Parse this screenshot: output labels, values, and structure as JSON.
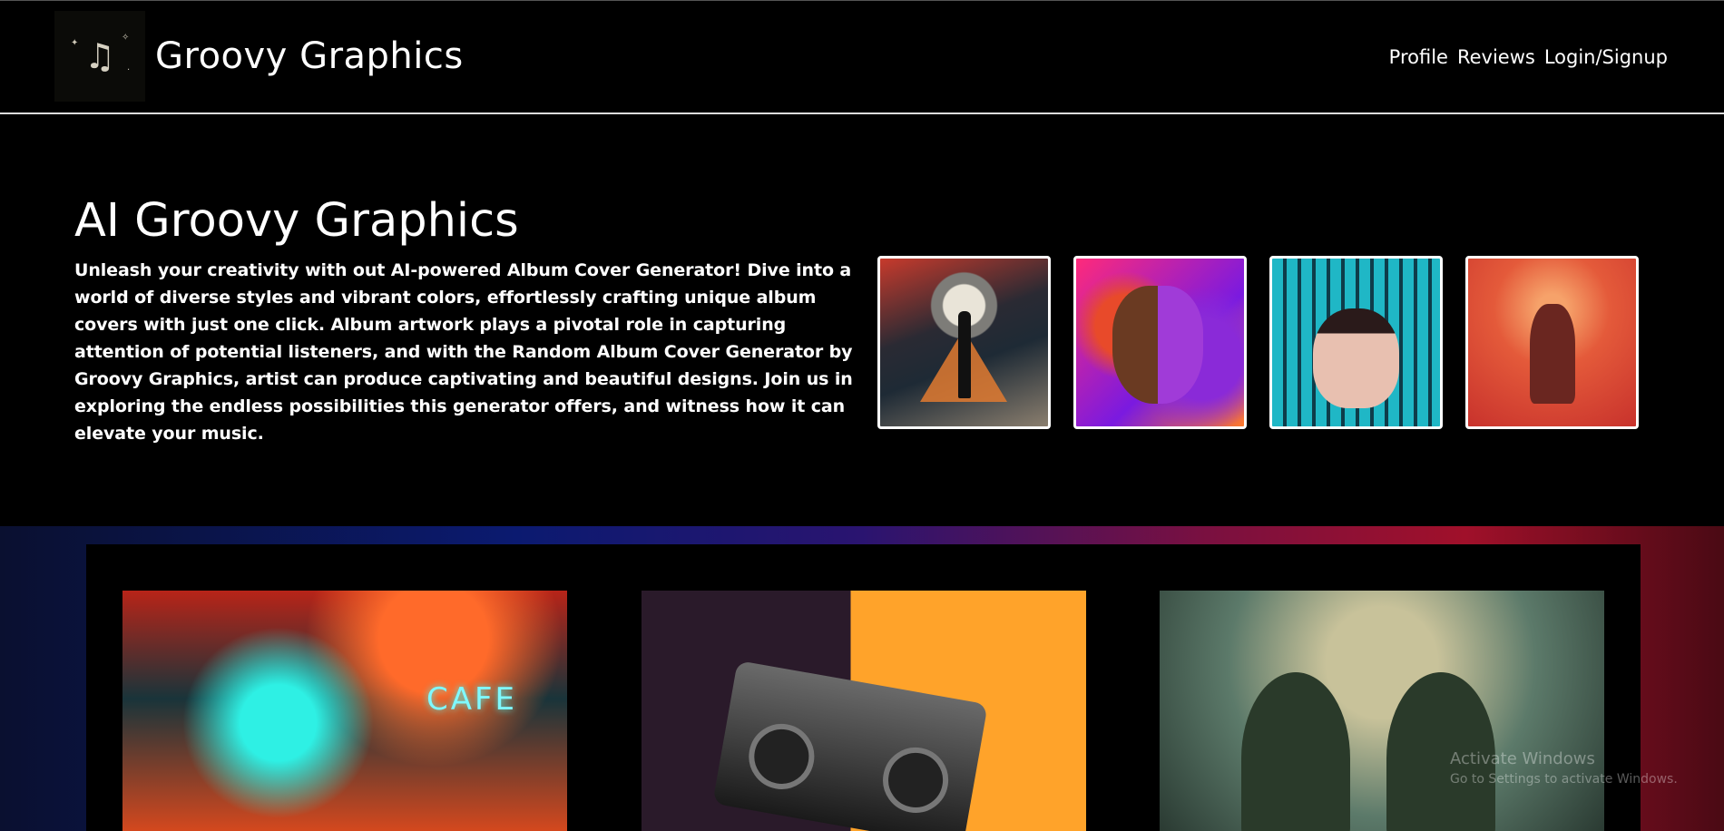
{
  "header": {
    "logo_icon": "music-notes-icon",
    "site_title": "Groovy Graphics",
    "nav": [
      "Profile",
      "Reviews",
      "Login/Signup"
    ]
  },
  "hero": {
    "title": "AI Groovy Graphics",
    "description": "Unleash your creativity with out AI-powered Album Cover Generator! Dive into a world of diverse styles and vibrant colors, effortlessly crafting unique album covers with just one click. Album artwork plays a pivotal role in capturing attention of potential listeners, and with the Random Album Cover Generator by Groovy Graphics, artist can produce captivating and beautiful designs. Join us in exploring the endless possibilities this generator offers, and witness how it can elevate your music."
  },
  "gallery": {
    "cafe_sign": "CAFE"
  },
  "watermark": {
    "title": "Activate Windows",
    "subtitle": "Go to Settings to activate Windows."
  },
  "colors": {
    "background": "#000000",
    "text": "#ffffff",
    "header_border": "#dddddd"
  }
}
